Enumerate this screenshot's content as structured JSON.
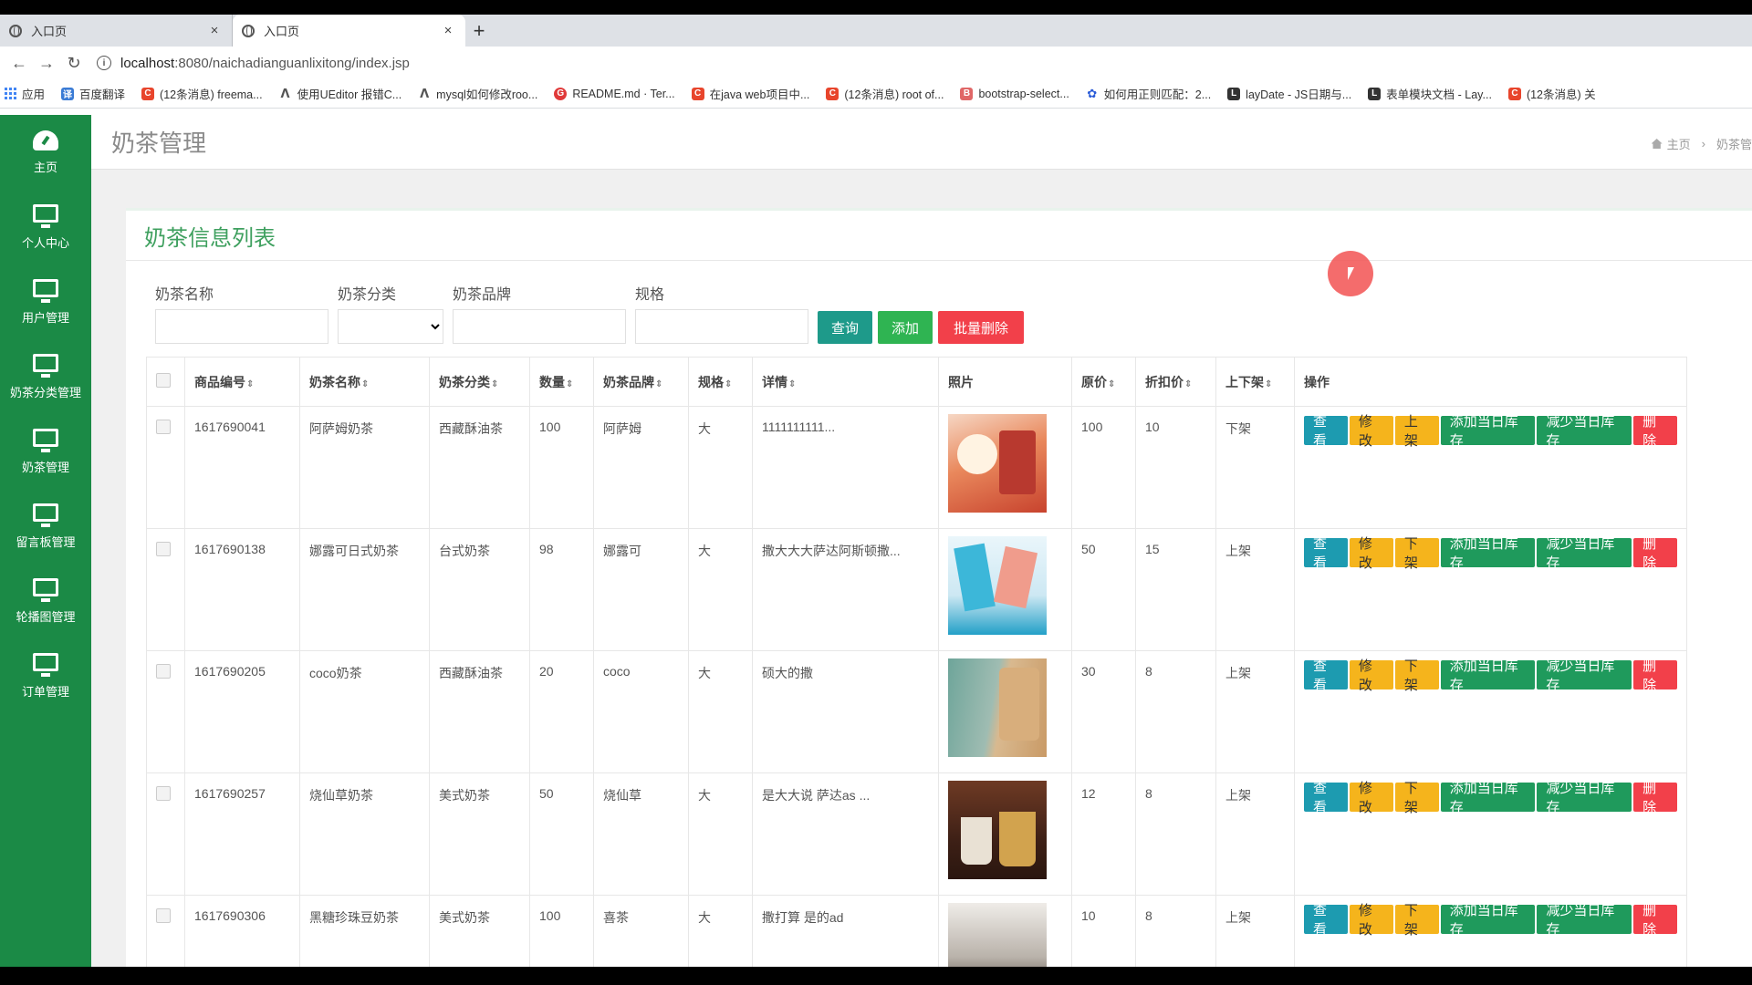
{
  "browser": {
    "tabs": [
      {
        "title": "入口页",
        "close": "×",
        "active": false
      },
      {
        "title": "入口页",
        "close": "×",
        "active": true
      }
    ],
    "new_tab": "+",
    "url_host": "localhost",
    "url_path": ":8080/naichadianguanlixitong/index.jsp",
    "bookmarks": [
      {
        "icon": "apps-icon",
        "label": "应用"
      },
      {
        "icon": "translate-icon",
        "label": "百度翻译"
      },
      {
        "icon": "csdn-icon",
        "label": "(12条消息) freema..."
      },
      {
        "icon": "ueditor-icon",
        "label": "使用UEditor 报错C..."
      },
      {
        "icon": "ueditor-icon",
        "label": "mysql如何修改roo..."
      },
      {
        "icon": "github-icon",
        "label": "README.md · Ter..."
      },
      {
        "icon": "csdn-icon",
        "label": "在java web项目中..."
      },
      {
        "icon": "csdn-icon",
        "label": "(12条消息) root of..."
      },
      {
        "icon": "bootstrap-icon",
        "label": "bootstrap-select..."
      },
      {
        "icon": "baidu-icon",
        "label": "如何用正则匹配：2..."
      },
      {
        "icon": "layui-icon",
        "label": "layDate - JS日期与..."
      },
      {
        "icon": "layui-icon",
        "label": "表单模块文档 - Lay..."
      },
      {
        "icon": "csdn-icon",
        "label": "(12条消息) 关"
      }
    ]
  },
  "sidebar": {
    "items": [
      {
        "label": "主页",
        "icon": "dashboard-icon"
      },
      {
        "label": "个人中心",
        "icon": "monitor-icon"
      },
      {
        "label": "用户管理",
        "icon": "monitor-icon"
      },
      {
        "label": "奶茶分类管理",
        "icon": "monitor-icon"
      },
      {
        "label": "奶茶管理",
        "icon": "monitor-icon"
      },
      {
        "label": "留言板管理",
        "icon": "monitor-icon"
      },
      {
        "label": "轮播图管理",
        "icon": "monitor-icon"
      },
      {
        "label": "订单管理",
        "icon": "monitor-icon"
      }
    ]
  },
  "header": {
    "title": "奶茶管理",
    "breadcrumb_home": "主页",
    "breadcrumb_sep": "›",
    "breadcrumb_current": "奶茶管"
  },
  "panel": {
    "title": "奶茶信息列表"
  },
  "search": {
    "name_label": "奶茶名称",
    "category_label": "奶茶分类",
    "brand_label": "奶茶品牌",
    "spec_label": "规格",
    "query_button": "查询",
    "add_button": "添加",
    "batch_delete_button": "批量删除"
  },
  "table": {
    "sort_glyph": "⇕",
    "headers": {
      "code": "商品编号",
      "name": "奶茶名称",
      "category": "奶茶分类",
      "qty": "数量",
      "brand": "奶茶品牌",
      "spec": "规格",
      "detail": "详情",
      "photo": "照片",
      "price": "原价",
      "discount": "折扣价",
      "status": "上下架",
      "ops": "操作"
    },
    "op_labels": {
      "view": "查看",
      "edit": "修改",
      "add_stock": "添加当日库存",
      "sub_stock": "减少当日库存",
      "delete": "删除"
    },
    "rows": [
      {
        "code": "1617690041",
        "name": "阿萨姆奶茶",
        "category": "西藏酥油茶",
        "qty": "100",
        "brand": "阿萨姆",
        "spec": "大",
        "detail": "1111111111...",
        "price": "100",
        "discount": "10",
        "status": "下架",
        "shelf_action": "上架"
      },
      {
        "code": "1617690138",
        "name": "娜露可日式奶茶",
        "category": "台式奶茶",
        "qty": "98",
        "brand": "娜露可",
        "spec": "大",
        "detail": "撒大大大萨达阿斯顿撒...",
        "price": "50",
        "discount": "15",
        "status": "上架",
        "shelf_action": "下架"
      },
      {
        "code": "1617690205",
        "name": "coco奶茶",
        "category": "西藏酥油茶",
        "qty": "20",
        "brand": "coco",
        "spec": "大",
        "detail": "硕大的撒",
        "price": "30",
        "discount": "8",
        "status": "上架",
        "shelf_action": "下架"
      },
      {
        "code": "1617690257",
        "name": "烧仙草奶茶",
        "category": "美式奶茶",
        "qty": "50",
        "brand": "烧仙草",
        "spec": "大",
        "detail": "是大大说 萨达as ...",
        "price": "12",
        "discount": "8",
        "status": "上架",
        "shelf_action": "下架"
      },
      {
        "code": "1617690306",
        "name": "黑糖珍珠豆奶茶",
        "category": "美式奶茶",
        "qty": "100",
        "brand": "喜茶",
        "spec": "大",
        "detail": "撒打算 是的ad",
        "price": "10",
        "discount": "8",
        "status": "上架",
        "shelf_action": "下架"
      }
    ]
  },
  "colors": {
    "sidebar_bg": "#1b8a46",
    "panel_title": "#3fa05f",
    "view_btn": "#1d9bb0",
    "edit_btn": "#f5b41c",
    "stock_btn": "#1f9a5c",
    "delete_btn": "#f2404a"
  }
}
